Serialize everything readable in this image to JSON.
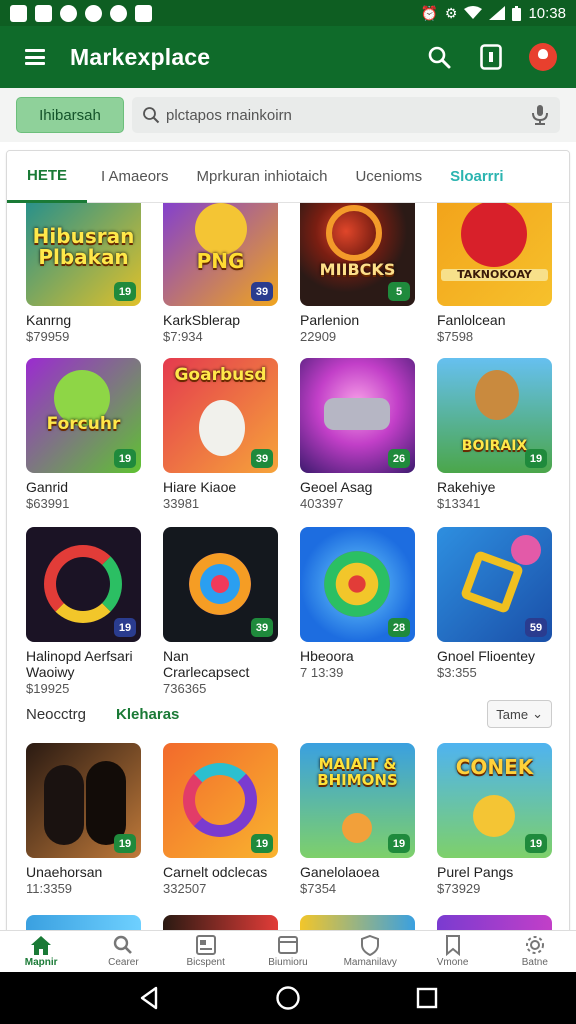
{
  "status_bar": {
    "time": "10:38",
    "left_icons": [
      "sim-icon",
      "mail-icon",
      "message-icon",
      "mute-icon",
      "heart-icon",
      "media-icon"
    ],
    "right_icons": [
      "alarm-icon",
      "vibrate-icon",
      "wifi-icon",
      "signal-icon",
      "battery-icon"
    ]
  },
  "app_bar": {
    "title": "Markexplace",
    "icons": [
      "menu-icon",
      "search-icon",
      "phone-icon",
      "notification-icon"
    ]
  },
  "search": {
    "chip_label": "Ihibarsah",
    "placeholder": "plctapos rnainkoirn"
  },
  "tabs": [
    {
      "label": "HETE",
      "active": true
    },
    {
      "label": "I Amaeors",
      "active": false
    },
    {
      "label": "Mprkuran inhiotaich",
      "active": false
    },
    {
      "label": "Ucenioms",
      "active": false
    },
    {
      "label": "Sloarrri",
      "active": false
    }
  ],
  "rows": [
    {
      "items": [
        {
          "name": "Kanrng",
          "price": "$79959",
          "badge": "19",
          "art": "Hibusran Plbakan",
          "colors": [
            "#1f8e8f",
            "#e0c12a"
          ]
        },
        {
          "name": "KarkSblerap",
          "price": "$7:934",
          "badge": "39",
          "art": "PNG",
          "colors": [
            "#7e3bd6",
            "#f0a51e"
          ]
        },
        {
          "name": "Parlenion",
          "price": "22909",
          "badge": "5",
          "art": "MIIBCKS",
          "colors": [
            "#2b1a16",
            "#e0462a"
          ]
        },
        {
          "name": "Fanlolcean",
          "price": "$7598",
          "badge": "",
          "art": "TAKNOKOAY",
          "colors": [
            "#f2a21a",
            "#d8202a"
          ]
        }
      ]
    },
    {
      "items": [
        {
          "name": "Ganrid",
          "price": "$63991",
          "badge": "19",
          "art": "Forcuhr",
          "colors": [
            "#9b2bd0",
            "#5fc331"
          ]
        },
        {
          "name": "Hiare Kiaoe",
          "price": "33981",
          "badge": "39",
          "art": "Goarbusd",
          "colors": [
            "#e43a4e",
            "#f6a43a"
          ]
        },
        {
          "name": "Geoel Asag",
          "price": "403397",
          "badge": "26",
          "art": "",
          "colors": [
            "#c23fc8",
            "#f067c0"
          ]
        },
        {
          "name": "Rakehiye",
          "price": "$13341",
          "badge": "19",
          "art": "BOIRAIX",
          "colors": [
            "#4ba64a",
            "#e8b837"
          ]
        }
      ]
    },
    {
      "items": [
        {
          "name": "Halinopd Aerfsari Waoiwy",
          "price": "$19925",
          "badge": "19",
          "art": "",
          "colors": [
            "#1b1325",
            "#e23c38"
          ]
        },
        {
          "name": "Nan Crarlecapsect",
          "price": "736365",
          "badge": "39",
          "art": "",
          "colors": [
            "#14181e",
            "#f59d24"
          ]
        },
        {
          "name": "Hbeoora",
          "price": "7 13:39",
          "badge": "28",
          "art": "",
          "colors": [
            "#1d6de0",
            "#f2c62a"
          ]
        },
        {
          "name": "Gnoel Flioentey",
          "price": "$3:355",
          "badge": "59",
          "art": "",
          "colors": [
            "#2e8fe0",
            "#f0c020"
          ]
        }
      ]
    }
  ],
  "section": {
    "label": "Neocctrg",
    "link": "Kleharas",
    "sort_label": "Tame"
  },
  "rows2": [
    {
      "items": [
        {
          "name": "Unaehorsan",
          "price": "11:3359",
          "badge": "19",
          "art": "",
          "colors": [
            "#2a1a12",
            "#c07a3a"
          ]
        },
        {
          "name": "Carnelt odclecas",
          "price": "332507",
          "badge": "19",
          "art": "",
          "colors": [
            "#f26a2c",
            "#7a3bd0"
          ]
        },
        {
          "name": "Ganelolaoea",
          "price": "$7354",
          "badge": "19",
          "art": "MAIAIT & BHIMONS",
          "colors": [
            "#3aa0e0",
            "#f2c02a"
          ]
        },
        {
          "name": "Purel Pangs",
          "price": "$73929",
          "badge": "19",
          "art": "CONEK",
          "colors": [
            "#4fb3f0",
            "#f08a2a"
          ]
        }
      ]
    }
  ],
  "bottom_nav": [
    {
      "label": "Mapnir",
      "icon": "home-icon",
      "active": true
    },
    {
      "label": "Cearer",
      "icon": "search-icon",
      "active": false
    },
    {
      "label": "Bicspent",
      "icon": "news-icon",
      "active": false
    },
    {
      "label": "Biumioru",
      "icon": "tab-icon",
      "active": false
    },
    {
      "label": "Mamanilavy",
      "icon": "shield-icon",
      "active": false
    },
    {
      "label": "Vmone",
      "icon": "bookmark-icon",
      "active": false
    },
    {
      "label": "Batne",
      "icon": "gear-icon",
      "active": false
    }
  ],
  "system_nav": [
    "back-icon",
    "home-circle-icon",
    "recents-icon"
  ]
}
